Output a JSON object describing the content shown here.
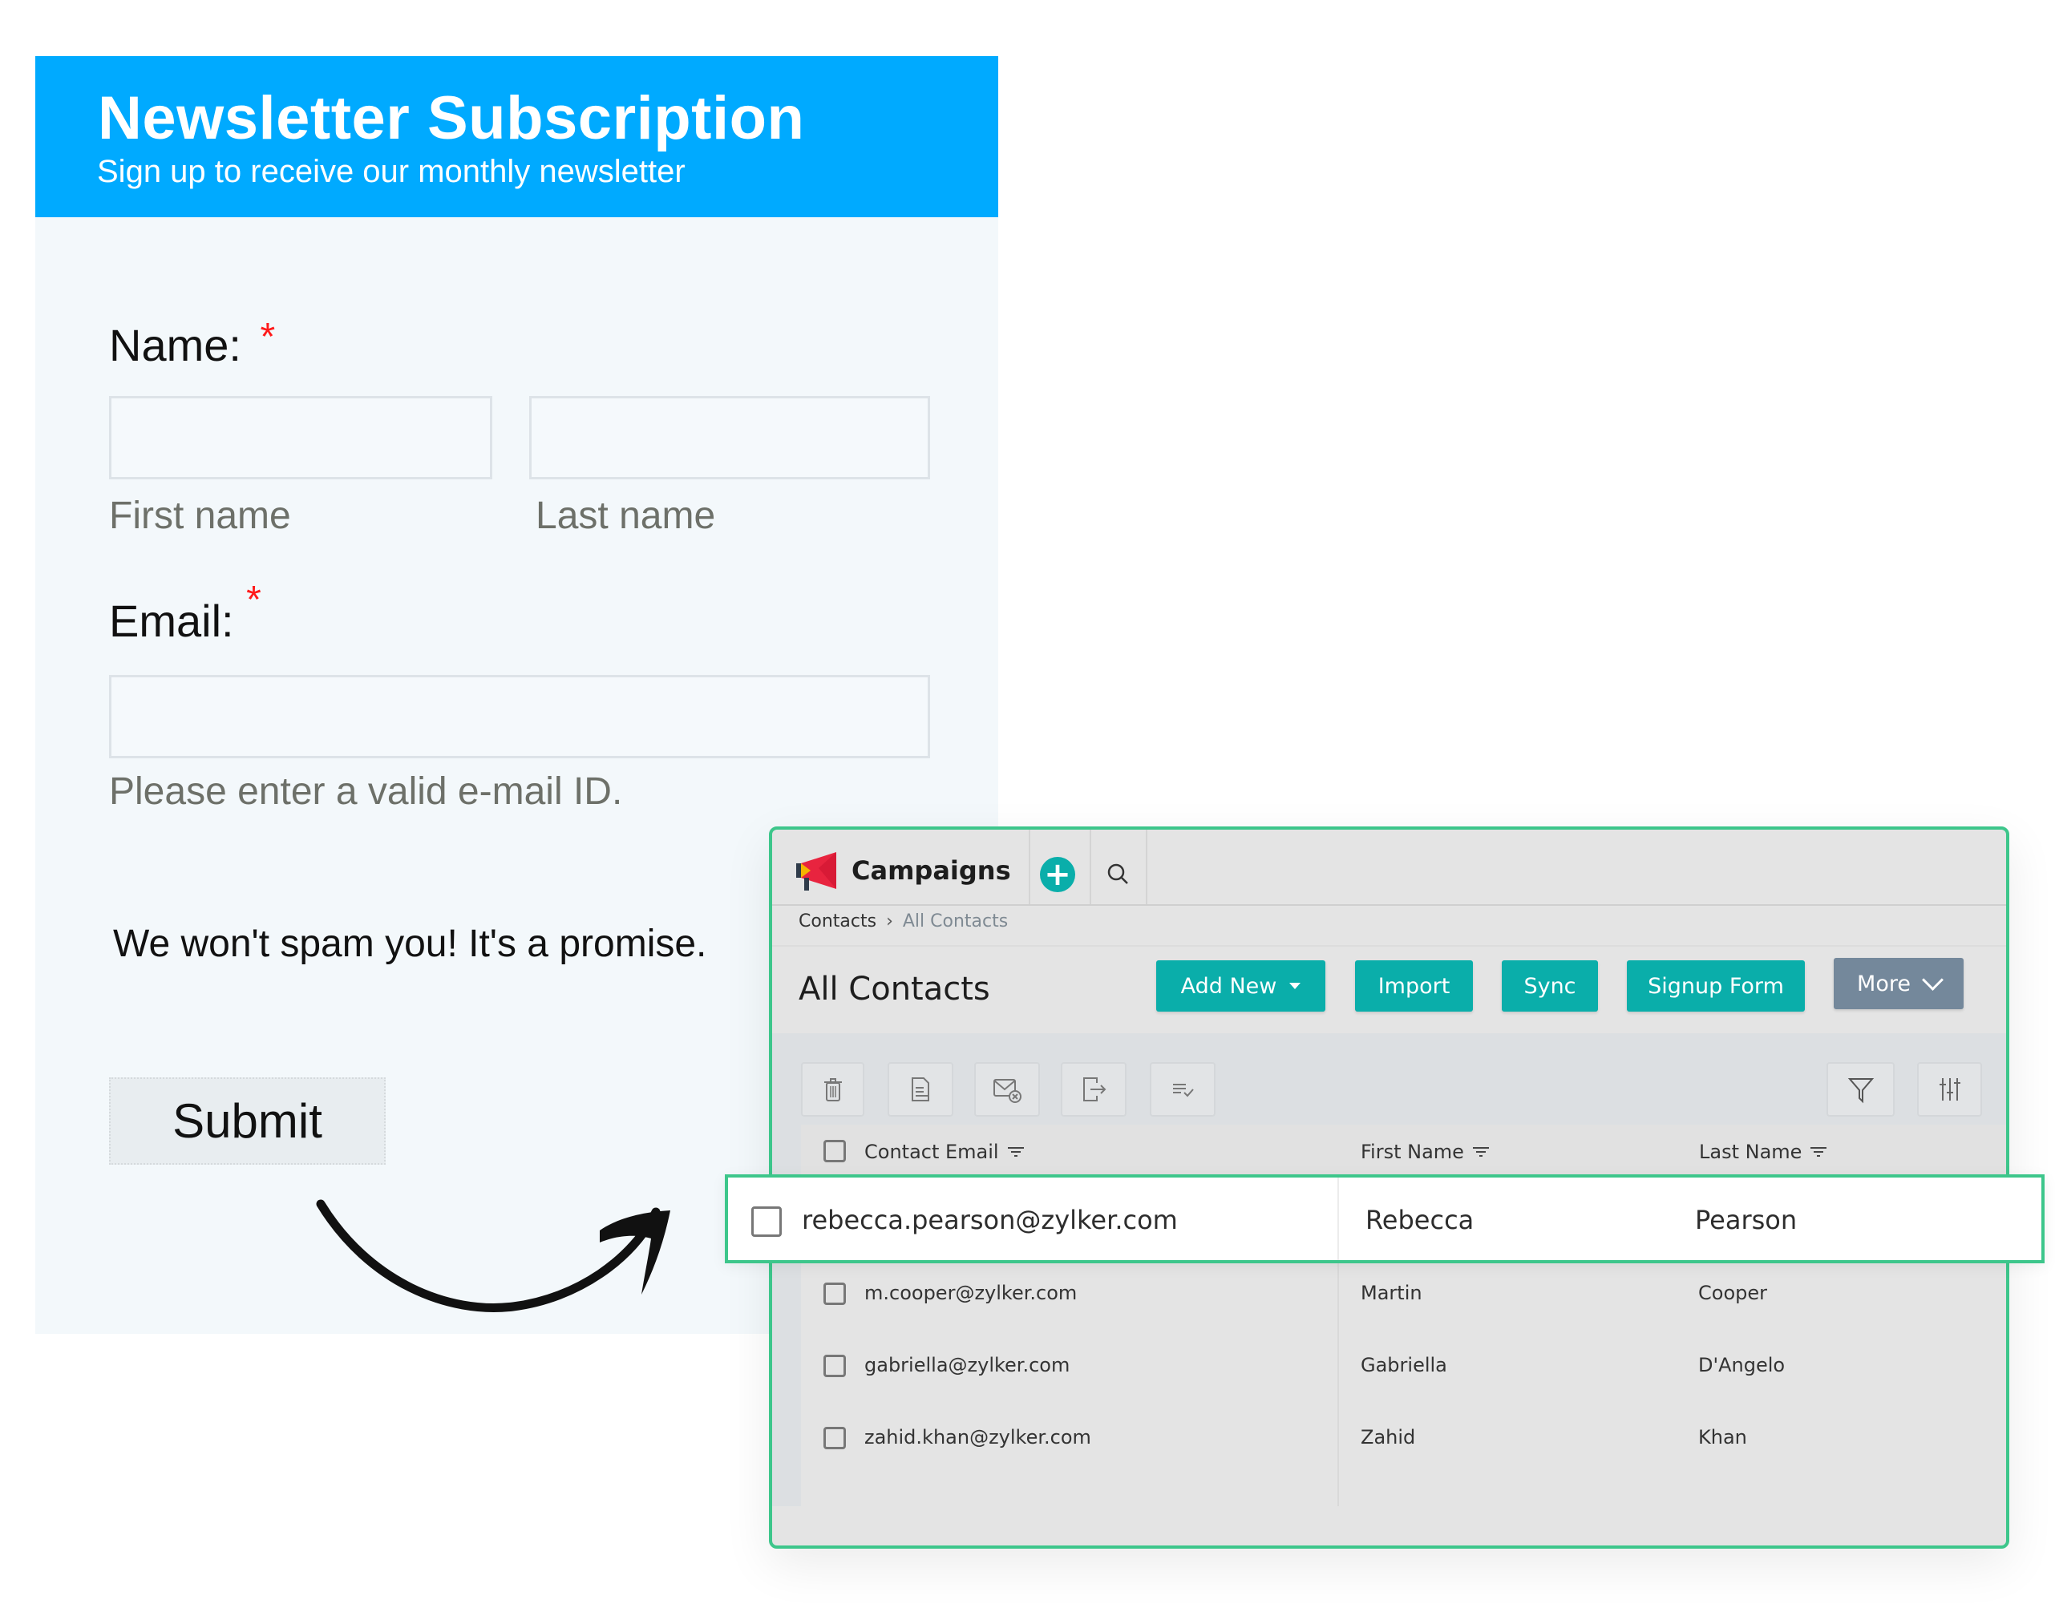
{
  "newsletter": {
    "title": "Newsletter Subscription",
    "subtitle": "Sign up to receive our monthly newsletter",
    "name_label": "Name:",
    "email_label": "Email:",
    "required_mark": "*",
    "first_name": {
      "value": "",
      "sublabel": "First name"
    },
    "last_name": {
      "value": "",
      "sublabel": "Last name"
    },
    "email": {
      "value": "",
      "hint": "Please enter a valid e-mail ID."
    },
    "promise_text": "We won't spam you! It's a promise.",
    "submit_label": "Submit",
    "header_color": "#00aaff",
    "required_color": "#ff1a1a"
  },
  "campaigns": {
    "app_name": "Campaigns",
    "icons": {
      "logo": "megaphone-icon",
      "add": "plus-circle-icon",
      "search": "search-icon"
    },
    "breadcrumb": [
      "Contacts",
      "All Contacts"
    ],
    "page_title": "All Contacts",
    "actions": {
      "add_new": "Add New",
      "import": "Import",
      "sync": "Sync",
      "signup_form": "Signup Form",
      "more": "More"
    },
    "toolbar_icons": [
      "trash-icon",
      "document-export-icon",
      "email-unsubscribe-icon",
      "logout-export-icon",
      "list-check-icon"
    ],
    "toolbar_right_icons": [
      "filter-icon",
      "column-settings-icon"
    ],
    "table": {
      "columns": [
        "Contact Email",
        "First Name",
        "Last Name"
      ],
      "highlighted_row": {
        "email": "rebecca.pearson@zylker.com",
        "first": "Rebecca",
        "last": "Pearson"
      },
      "rows": [
        {
          "email": "m.cooper@zylker.com",
          "first": "Martin",
          "last": "Cooper"
        },
        {
          "email": "gabriella@zylker.com",
          "first": "Gabriella",
          "last": "D'Angelo"
        },
        {
          "email": "zahid.khan@zylker.com",
          "first": "Zahid",
          "last": "Khan"
        }
      ]
    },
    "accent_color": "#0aaeaa",
    "highlight_border_color": "#3dc68b",
    "more_button_color": "#74889b"
  }
}
